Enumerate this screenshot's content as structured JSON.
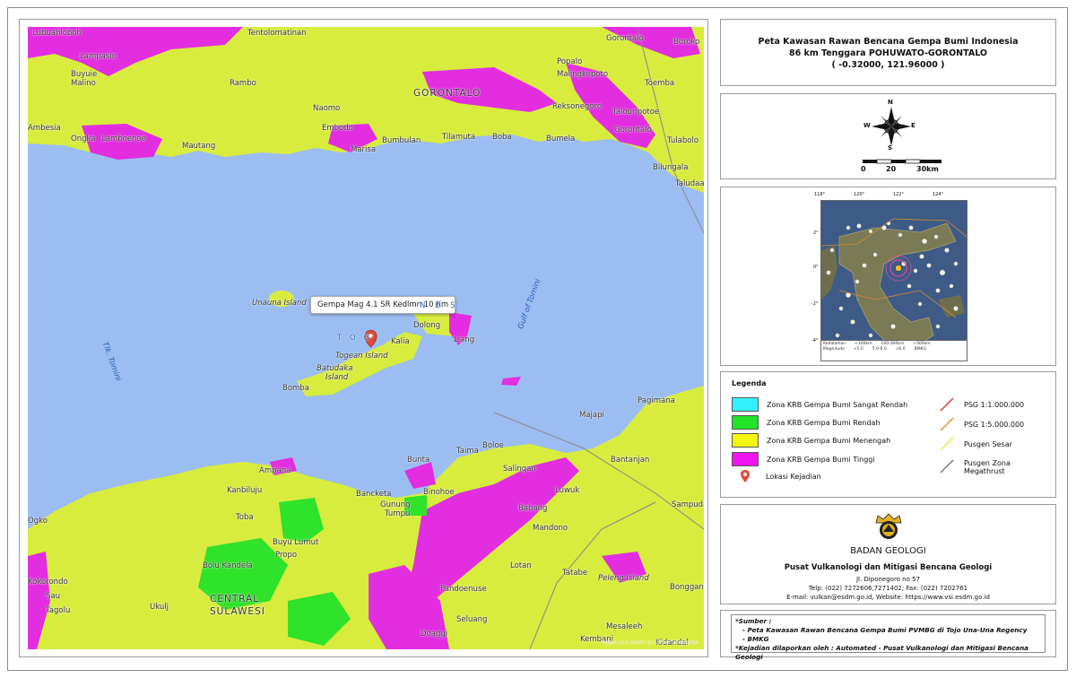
{
  "title": {
    "line1": "Peta Kawasan Rawan Bencana Gempa Bumi Indonesia",
    "line2": "86 km Tenggara POHUWATO-GORONTALO",
    "line3": "( -0.32000, 121.96000 )"
  },
  "compass": {
    "n": "N",
    "s": "S",
    "e": "E",
    "w": "W"
  },
  "scale": {
    "ticks": [
      "0",
      "20",
      "30km"
    ]
  },
  "map": {
    "popup": "Gempa Mag 4.1 SR Kedlmn 10 Km",
    "attribution": "https://vsi.esdm.go.id/portalmagma",
    "places": {
      "lubuahloboh": "Lubuahloboh",
      "tentolomatinan": "Tentolomatinan",
      "gorontalo_top": "Gorontalo",
      "boroko": "Boroko",
      "lampasio": "Lampasio",
      "buyuie": "Buyuie",
      "malino": "Malino",
      "rambo": "Rambo",
      "popalo": "Popalo",
      "malingkepoto": "Malingkepoto",
      "gorontalo": "GORONTALO",
      "toemba": "Toemba",
      "naomo": "Naomo",
      "reksonegoro": "Reksonegoro",
      "talouripotoe": "Talouripotoe",
      "ambesia": "Ambesia",
      "ongka": "Ongka",
      "lamboenoe": "Lamboenoe",
      "embodo": "Embodo",
      "bumbulan": "Bumbulan",
      "bumela": "Bumela",
      "gorontalo2": "Gorontalo",
      "tulabolo": "Tulabolo",
      "mautang": "Mautang",
      "marisa": "Marisa",
      "tilamuta": "Tilamuta",
      "boba": "Boba",
      "bilungala": "Bilungala",
      "taludaa": "Taludaa",
      "unauna": "Unauna Island",
      "togean_l": "T O G",
      "togean_r": "N D S",
      "dolong": "Dolong",
      "kalia": "Kalia",
      "liang": "Liang",
      "togean_island": "Togean Island",
      "batudaka": "Batudaka",
      "batudaka2": "Island",
      "bomba": "Bomba",
      "gulf": "Gulf of Tomini",
      "tomini": "Tlk. Tomini",
      "pagimana": "Pagimana",
      "majapi": "Majapi",
      "boloe": "Boloe",
      "taima": "Taima",
      "bunta": "Bunta",
      "bantanjan": "Bantanjan",
      "salingan": "Salingan",
      "ampana": "Ampana",
      "kanbiluju": "Kanbiluju",
      "bancketa": "Bancketa",
      "binohoe": "Binohoe",
      "luwuk": "Luwuk",
      "gunung": "Gunung",
      "tumpu": "Tumpu",
      "babang": "Babang",
      "sampuda": "Sampuda",
      "toba": "Toba",
      "mandono": "Mandono",
      "buyu_lumut": "Buyu Lumut",
      "bolu_kandela": "Bolu Kandela",
      "propo": "Propo",
      "kokorondo": "Kokorondo",
      "lotan": "Lotan",
      "tatabe": "Tatabe",
      "peleng": "Peleng Island",
      "ogko": "Ogko",
      "central": "CENTRAL",
      "sulawesi": "SULAWESI",
      "sau": "Sau",
      "tagolu": "Tagolu",
      "ukulj": "Ukulj",
      "pandoenuse": "Pandoenuse",
      "bongganan": "Bongganan",
      "seluang": "Seluang",
      "mesaleeh": "Mesaleeh",
      "doaggi": "Doaggi",
      "kembani": "Kembani",
      "kidandal": "Kidandal"
    }
  },
  "inset": {
    "lon_ticks": [
      "118°",
      "120°",
      "122°",
      "124°"
    ],
    "lat_ticks": [
      "2°",
      "0°",
      "-2°",
      "-4°"
    ],
    "legend_row1": [
      "Kedalaman",
      "<100km",
      "100-300km",
      ">300km"
    ],
    "legend_row2": [
      "Magnitude",
      "<5.0",
      "5.0-6.0",
      ">6.0",
      "BMKG"
    ]
  },
  "legend": {
    "title": "Legenda",
    "items": [
      {
        "label": "Zona KRB Gempa Bumi Sangat Rendah",
        "color": "#33f0ff"
      },
      {
        "label": "Zona KRB Gempa Bumi Rendah",
        "color": "#22e22a"
      },
      {
        "label": "Zona KRB Gempa Bumi Menengah",
        "color": "#f4f411"
      },
      {
        "label": "Zona KRB Gempa Bumi Tinggi",
        "color": "#f014f0"
      },
      {
        "label": "Lokasi Kejadian",
        "color": "#e04a3a"
      }
    ],
    "lines": [
      {
        "label": "PSG 1:1.000.000",
        "color": "#e53935"
      },
      {
        "label": "PSG 1:5.000.000",
        "color": "#f0902a"
      },
      {
        "label": "Pusgen Sesar",
        "color": "#f6e44a"
      },
      {
        "label": "Pusgen Zona",
        "label2": "Megathrust",
        "color": "#777777"
      }
    ]
  },
  "logo": {
    "org": "BADAN GEOLOGI",
    "center": "Pusat Vulkanologi dan Mitigasi Bencana Geologi",
    "address": "Jl. Diponegoro no 57",
    "phone": "Telp: (022) 7272606,7271402; Fax: (022) 7202761",
    "email": "E-mail: vulkan@esdm.go.id, Website: https://www.vsi.esdm.go.id"
  },
  "sources": {
    "heading": "*Sumber :",
    "s1": "- Peta Kawasan Rawan Bencana Gempa Bumi PVMBG di Tojo Una-Una Regency",
    "s2": "- BMKG",
    "report": "*Kejadian dilaporkan oleh : Automated - Pusat Vulkanologi dan Mitigasi Bencana Geologi"
  }
}
